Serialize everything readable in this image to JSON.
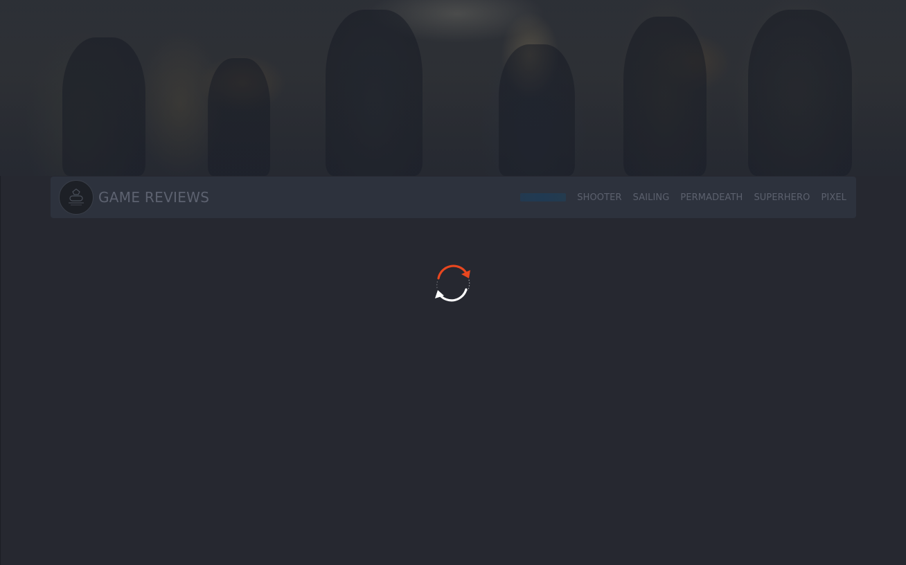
{
  "site": {
    "title": "GAME REVIEWS",
    "logo_icon": "game-controller-emblem-icon"
  },
  "nav": {
    "items": [
      {
        "label": "SHOOTER",
        "active": false
      },
      {
        "label": "SAILING",
        "active": false
      },
      {
        "label": "PERMADEATH",
        "active": false
      },
      {
        "label": "SUPERHERO",
        "active": false
      },
      {
        "label": "PIXEL",
        "active": false
      }
    ],
    "active_item_visible_text": ""
  },
  "loader": {
    "icon": "refresh-spinner-icon",
    "colors": {
      "top_arrow": "#e8471f",
      "bottom_arrow": "#ffffff"
    }
  },
  "colors": {
    "page_background": "#262830",
    "navbar_background": "#2d323d",
    "nav_text": "#5c616e",
    "nav_active": "#1e4a6a"
  }
}
